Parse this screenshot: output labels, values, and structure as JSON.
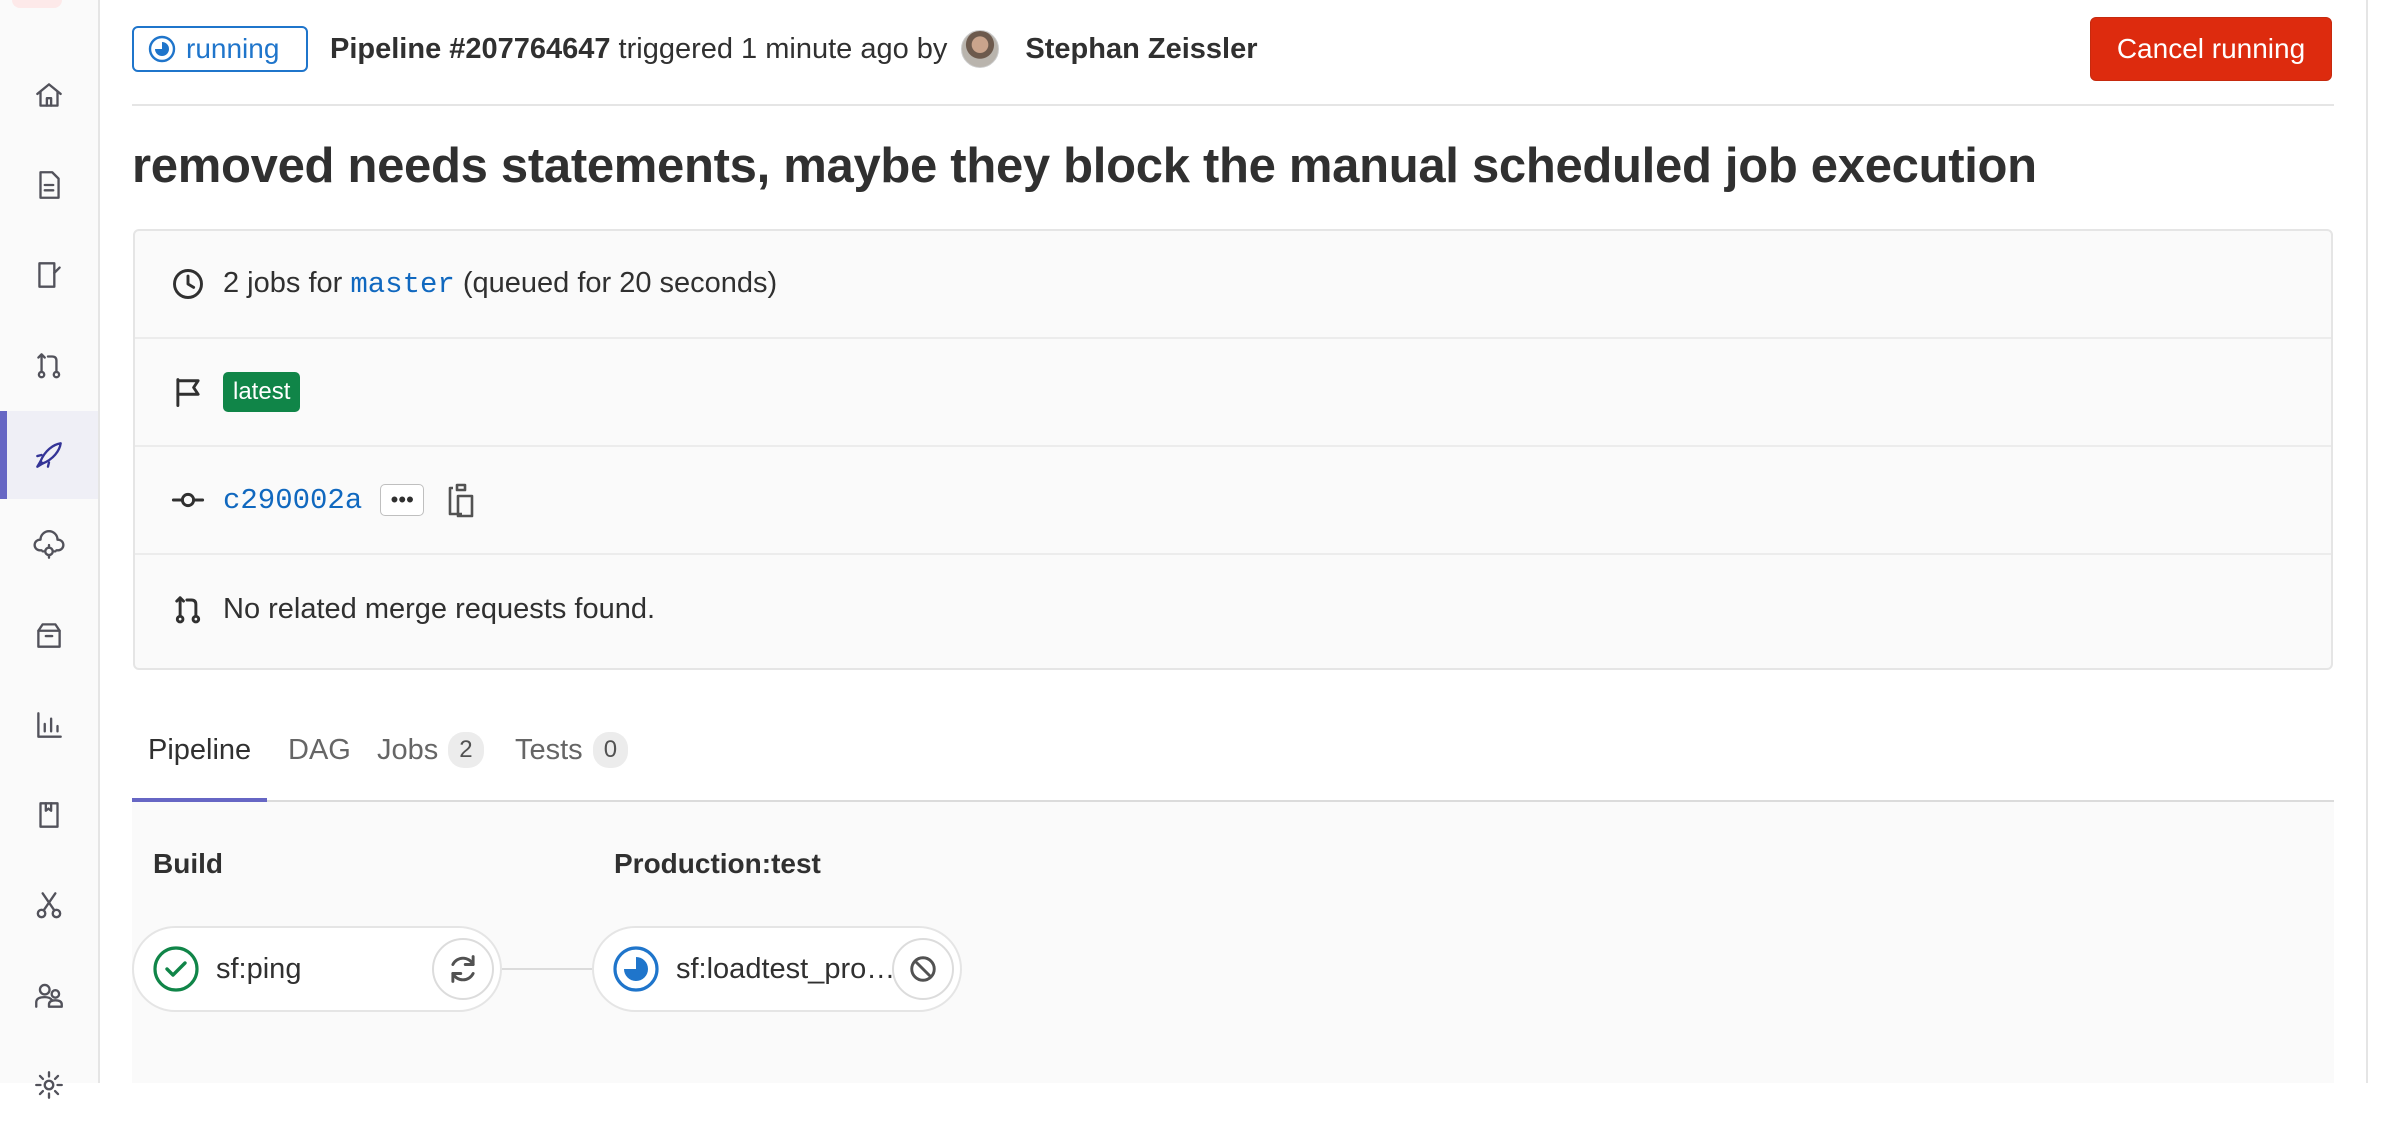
{
  "sidebar": {
    "items": [
      {
        "icon": "home-icon"
      },
      {
        "icon": "file-icon"
      },
      {
        "icon": "issues-icon"
      },
      {
        "icon": "merge-request-icon"
      },
      {
        "icon": "rocket-icon",
        "active": true
      },
      {
        "icon": "cloud-gear-icon"
      },
      {
        "icon": "package-icon"
      },
      {
        "icon": "chart-icon"
      },
      {
        "icon": "book-icon"
      },
      {
        "icon": "snippet-icon"
      },
      {
        "icon": "users-icon"
      },
      {
        "icon": "settings-icon"
      }
    ]
  },
  "header": {
    "status": "running",
    "pipeline_label": "Pipeline #207764647",
    "triggered_text": "triggered 1 minute ago by",
    "author": "Stephan Zeissler",
    "cancel_label": "Cancel running"
  },
  "commit_title": "removed needs statements, maybe they block the manual scheduled job execution",
  "info": {
    "jobs_prefix": "2 jobs for",
    "branch": "master",
    "queued_text": "(queued for 20 seconds)",
    "latest_badge": "latest",
    "commit_sha": "c290002a",
    "ellipsis": "•••",
    "merge_requests": "No related merge requests found."
  },
  "tabs": [
    {
      "label": "Pipeline",
      "active": true
    },
    {
      "label": "DAG"
    },
    {
      "label": "Jobs",
      "count": "2"
    },
    {
      "label": "Tests",
      "count": "0"
    }
  ],
  "stages": [
    {
      "title": "Build",
      "job": {
        "name": "sf:ping",
        "status": "success",
        "action": "retry"
      }
    },
    {
      "title": "Production:test",
      "job": {
        "name": "sf:loadtest_production",
        "status": "running",
        "action": "cancel"
      }
    }
  ],
  "colors": {
    "running": "#1f75cb",
    "success": "#108548",
    "danger": "#dd2b0e",
    "link": "#1068bf",
    "nav_active": "#6666c4"
  }
}
